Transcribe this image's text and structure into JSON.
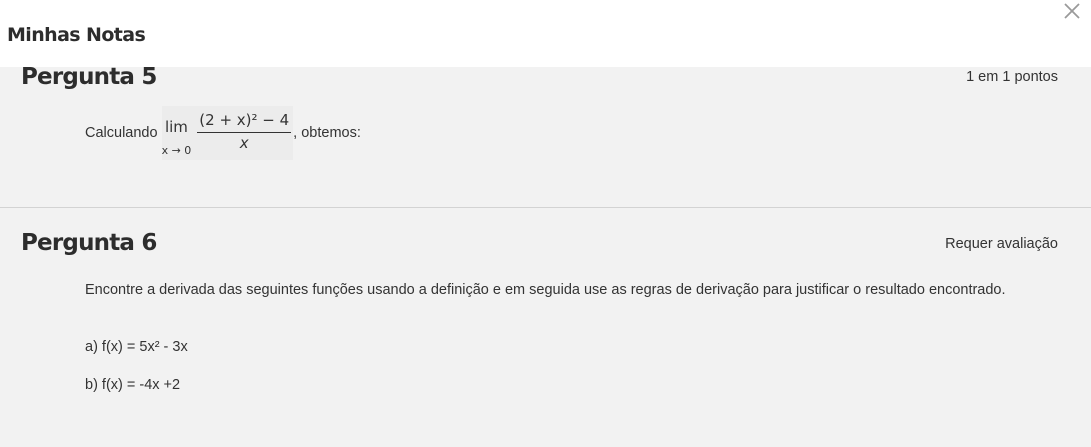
{
  "header": {
    "title": "Minhas Notas",
    "close_icon": "close-icon"
  },
  "questions": [
    {
      "title": "Pergunta 5",
      "points": "1 em 1 pontos",
      "prefix": "Calculando",
      "math": {
        "lim": "lim",
        "lim_sub": "x → 0",
        "numerator": "(2 + x)² − 4",
        "denominator": "x"
      },
      "suffix": ", obtemos:"
    },
    {
      "title": "Pergunta 6",
      "points": "Requer avaliação",
      "text": "Encontre a derivada das seguintes funções usando a definição e em seguida use as regras de derivação para justificar o resultado encontrado.",
      "item_a": "a) f(x) = 5x² - 3x",
      "item_b": "b) f(x) = -4x +2"
    }
  ]
}
